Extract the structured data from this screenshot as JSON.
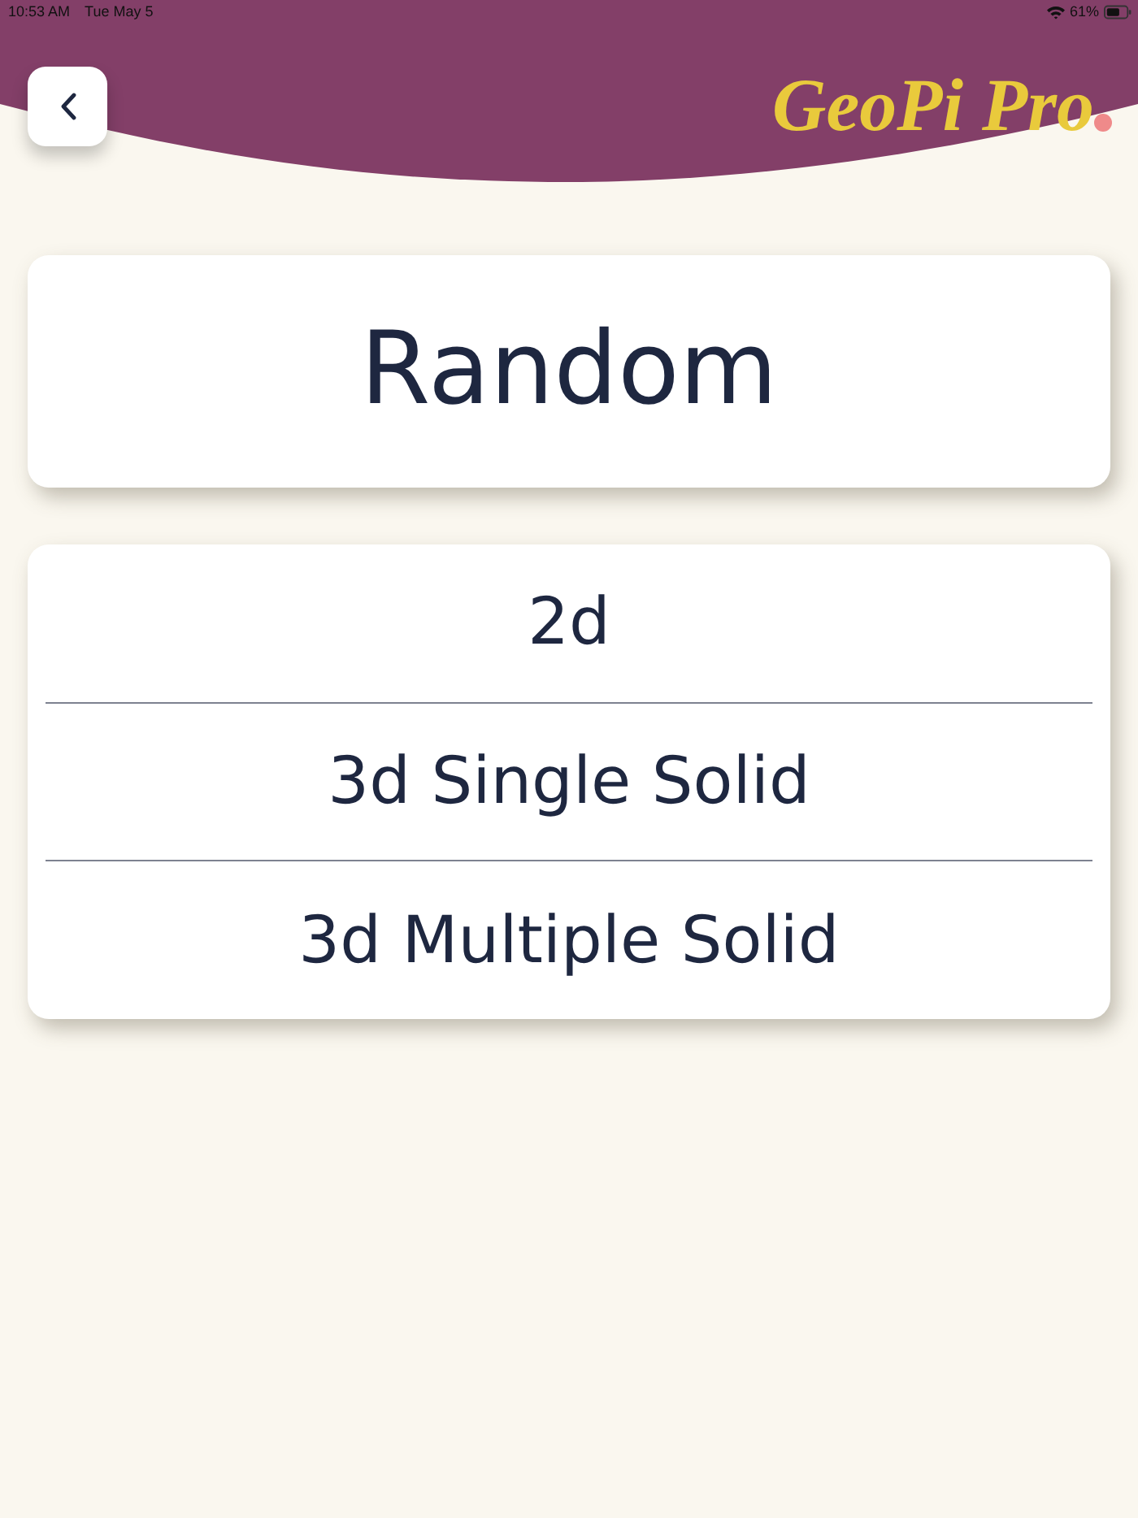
{
  "status_bar": {
    "time": "10:53 AM",
    "date": "Tue May 5",
    "battery": "61%"
  },
  "header": {
    "logo": "GeoPi Pro"
  },
  "title_card": {
    "label": "Random"
  },
  "options": [
    {
      "label": "2d"
    },
    {
      "label": "3d Single Solid"
    },
    {
      "label": "3d Multiple Solid"
    }
  ]
}
